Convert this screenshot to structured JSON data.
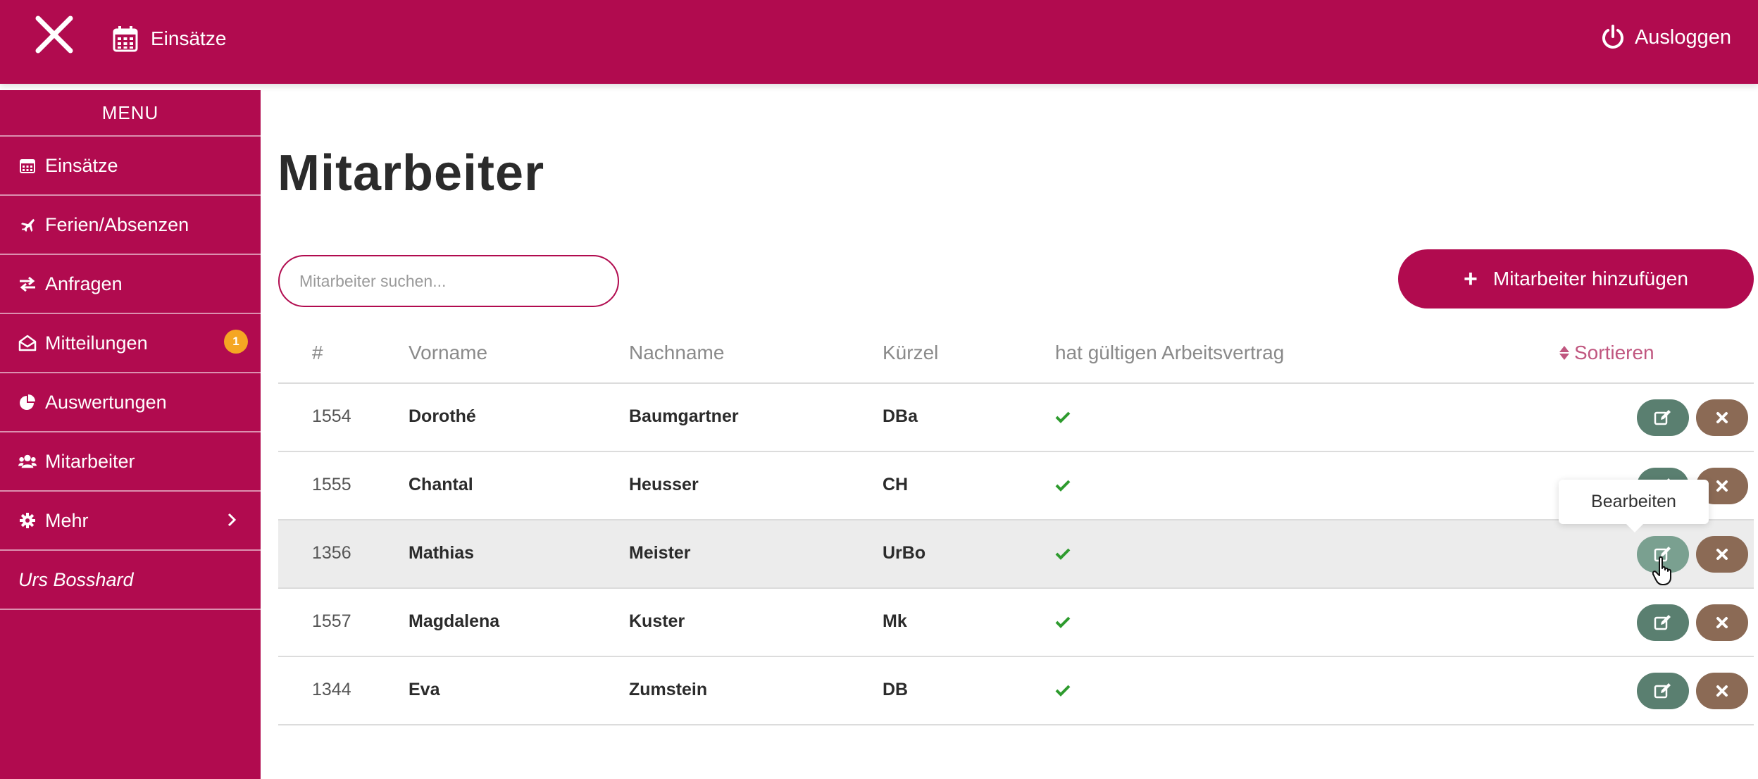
{
  "topbar": {
    "nav_label": "Einsätze",
    "logout_label": "Ausloggen"
  },
  "sidebar": {
    "menu_title": "MENU",
    "items": [
      {
        "label": "Einsätze",
        "icon": "calendar-icon"
      },
      {
        "label": "Ferien/Absenzen",
        "icon": "plane-icon"
      },
      {
        "label": "Anfragen",
        "icon": "exchange-icon"
      },
      {
        "label": "Mitteilungen",
        "icon": "envelope-open-icon",
        "badge": "1"
      },
      {
        "label": "Auswertungen",
        "icon": "pie-chart-icon"
      },
      {
        "label": "Mitarbeiter",
        "icon": "users-icon"
      },
      {
        "label": "Mehr",
        "icon": "gear-icon"
      }
    ],
    "user": "Urs Bosshard"
  },
  "main": {
    "title": "Mitarbeiter",
    "search_placeholder": "Mitarbeiter suchen...",
    "add_button": "Mitarbeiter hinzufügen",
    "columns": {
      "num": "#",
      "vorname": "Vorname",
      "nachname": "Nachname",
      "kuerzel": "Kürzel",
      "vertrag": "hat gültigen Arbeitsvertrag",
      "sort": "Sortieren"
    },
    "rows": [
      {
        "num": "1554",
        "vorname": "Dorothé",
        "nachname": "Baumgartner",
        "kuerzel": "DBa",
        "vertrag": true
      },
      {
        "num": "1555",
        "vorname": "Chantal",
        "nachname": "Heusser",
        "kuerzel": "CH",
        "vertrag": true
      },
      {
        "num": "1356",
        "vorname": "Mathias",
        "nachname": "Meister",
        "kuerzel": "UrBo",
        "vertrag": true
      },
      {
        "num": "1557",
        "vorname": "Magdalena",
        "nachname": "Kuster",
        "kuerzel": "Mk",
        "vertrag": true
      },
      {
        "num": "1344",
        "vorname": "Eva",
        "nachname": "Zumstein",
        "kuerzel": "DB",
        "vertrag": true
      }
    ],
    "tooltip": "Bearbeiten"
  },
  "colors": {
    "brand": "#b10b4f",
    "edit_button": "#5a7f70",
    "delete_button": "#8b6a55",
    "badge": "#f5a623",
    "check": "#2e9b2e"
  }
}
